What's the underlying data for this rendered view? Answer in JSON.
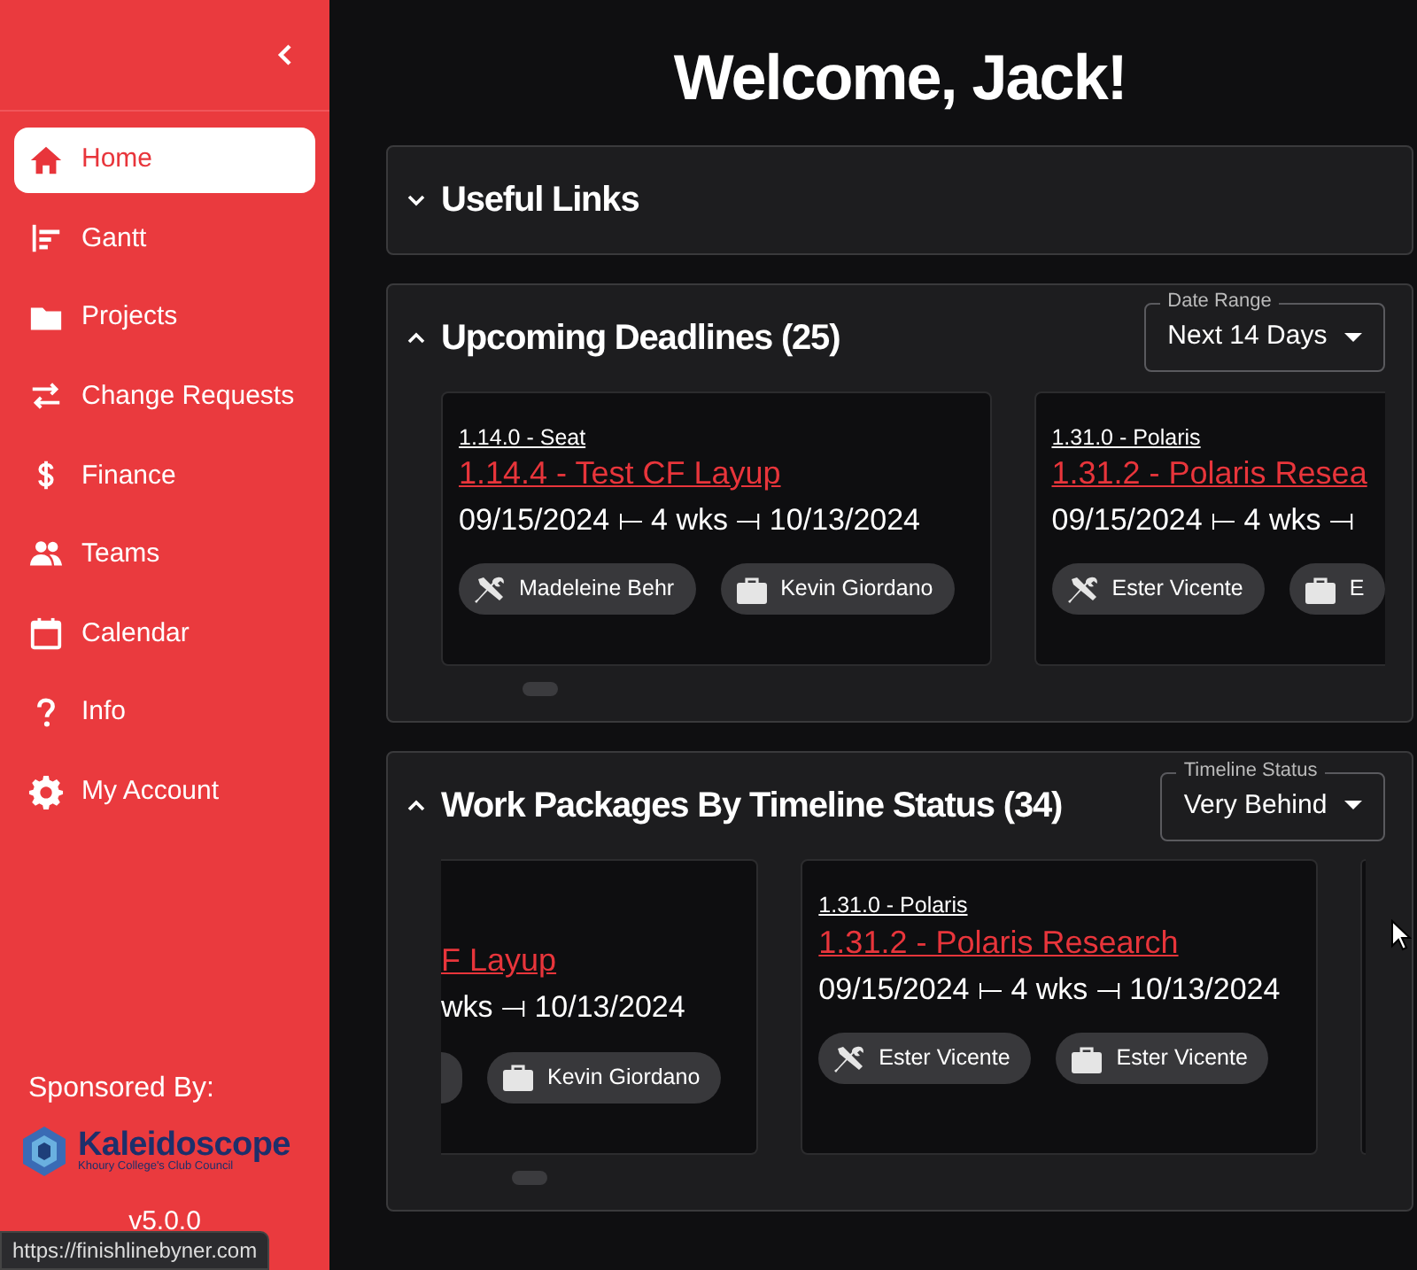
{
  "sidebar": {
    "items": [
      {
        "label": "Home",
        "selected": true
      },
      {
        "label": "Gantt",
        "selected": false
      },
      {
        "label": "Projects",
        "selected": false
      },
      {
        "label": "Change Requests",
        "selected": false
      },
      {
        "label": "Finance",
        "selected": false
      },
      {
        "label": "Teams",
        "selected": false
      },
      {
        "label": "Calendar",
        "selected": false
      },
      {
        "label": "Info",
        "selected": false
      },
      {
        "label": "My Account",
        "selected": false
      }
    ],
    "sponsor_label": "Sponsored By:",
    "sponsor_name": "Kaleidoscope",
    "sponsor_tagline": "Khoury College's Club Council",
    "version": "v5.0.0"
  },
  "heading": "Welcome, Jack!",
  "sections": [
    {
      "title": "Useful Links",
      "expanded": false
    },
    {
      "title": "Upcoming Deadlines (25)",
      "expanded": true,
      "filter": {
        "label": "Date Range",
        "value": "Next 14 Days"
      },
      "cards": [
        {
          "kind": "full",
          "project": "1.14.0 - Seat",
          "title": "1.14.4 - Test CF Layup",
          "dates": "09/15/2024 ⟝ 4 wks ⟞ 10/13/2024",
          "lead": "Madeleine Behr",
          "manager": "Kevin Giordano"
        },
        {
          "kind": "cut_right",
          "project": "1.31.0 - Polaris",
          "title": "1.31.2 - Polaris Resea",
          "dates": "09/15/2024 ⟝ 4 wks ⟞",
          "lead": "Ester Vicente",
          "manager": "E"
        }
      ]
    },
    {
      "title": "Work Packages By Timeline Status (34)",
      "expanded": true,
      "filter": {
        "label": "Timeline Status",
        "value": "Very Behind"
      },
      "cards": [
        {
          "kind": "cut_left",
          "title": "F Layup",
          "dates": "wks ⟞ 10/13/2024",
          "manager": "Kevin Giordano"
        },
        {
          "kind": "full",
          "project": "1.31.0 - Polaris",
          "title": "1.31.2 - Polaris Research",
          "dates": "09/15/2024 ⟝ 4 wks ⟞ 10/13/2024",
          "lead": "Ester Vicente",
          "manager": "Ester Vicente"
        },
        {
          "kind": "edge"
        }
      ]
    }
  ],
  "status_url": "https://finishlinebyner.com"
}
